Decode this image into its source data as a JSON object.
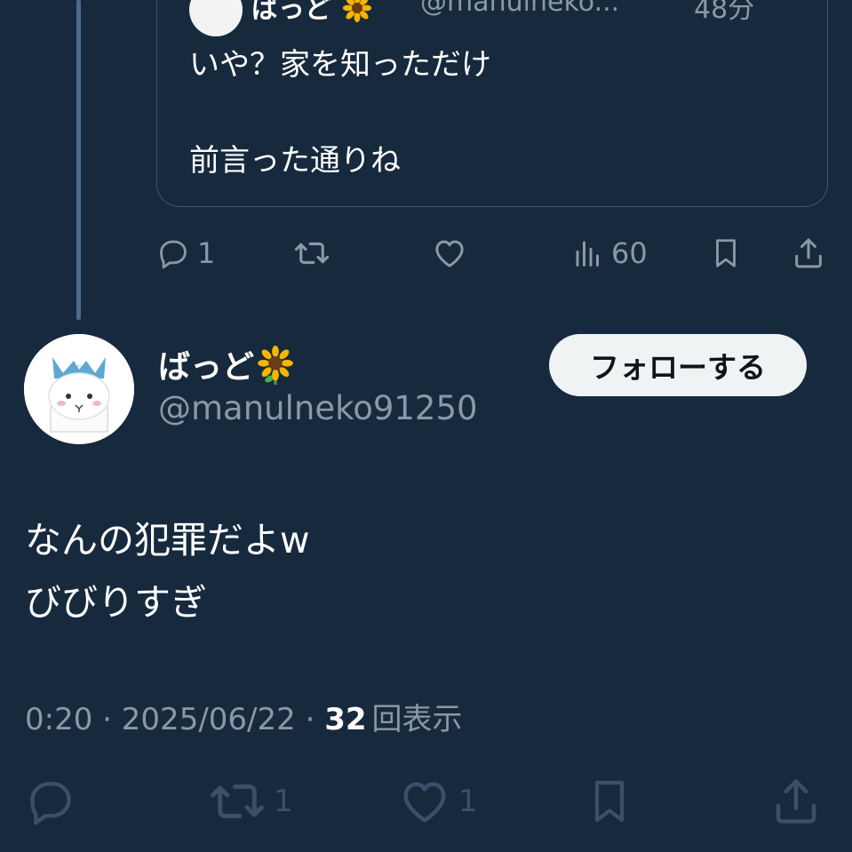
{
  "quoted_tweet": {
    "author_name": "ばっど",
    "author_emoji": "🌻",
    "handle": "@manulneko...",
    "time": "48分",
    "lines": [
      "いや？家を知っただけ",
      "",
      "前言った通りね"
    ]
  },
  "reply_actions": {
    "reply_count": "1",
    "retweet_count": "",
    "like_count": "",
    "views": "60"
  },
  "main_tweet": {
    "author_name": "ばっど",
    "author_emoji": "🌻",
    "handle": "@manulneko91250",
    "follow_label": "フォローする",
    "lines": [
      "なんの犯罪だよw",
      "びびりすぎ"
    ],
    "time": "0:20",
    "separator": " · ",
    "date": "2025/06/22",
    "views_count": "32",
    "views_label": "回表示",
    "reply_count": "",
    "retweet_count": "1",
    "like_count": "1"
  },
  "colors": {
    "background": "#17293d",
    "muted_text": "#8b98a5",
    "thread_line": "#4e6b8c",
    "follow_button_bg": "#eff3f4"
  },
  "icons": [
    "reply-icon",
    "retweet-icon",
    "like-icon",
    "views-icon",
    "bookmark-icon",
    "share-icon",
    "sunflower-icon"
  ]
}
